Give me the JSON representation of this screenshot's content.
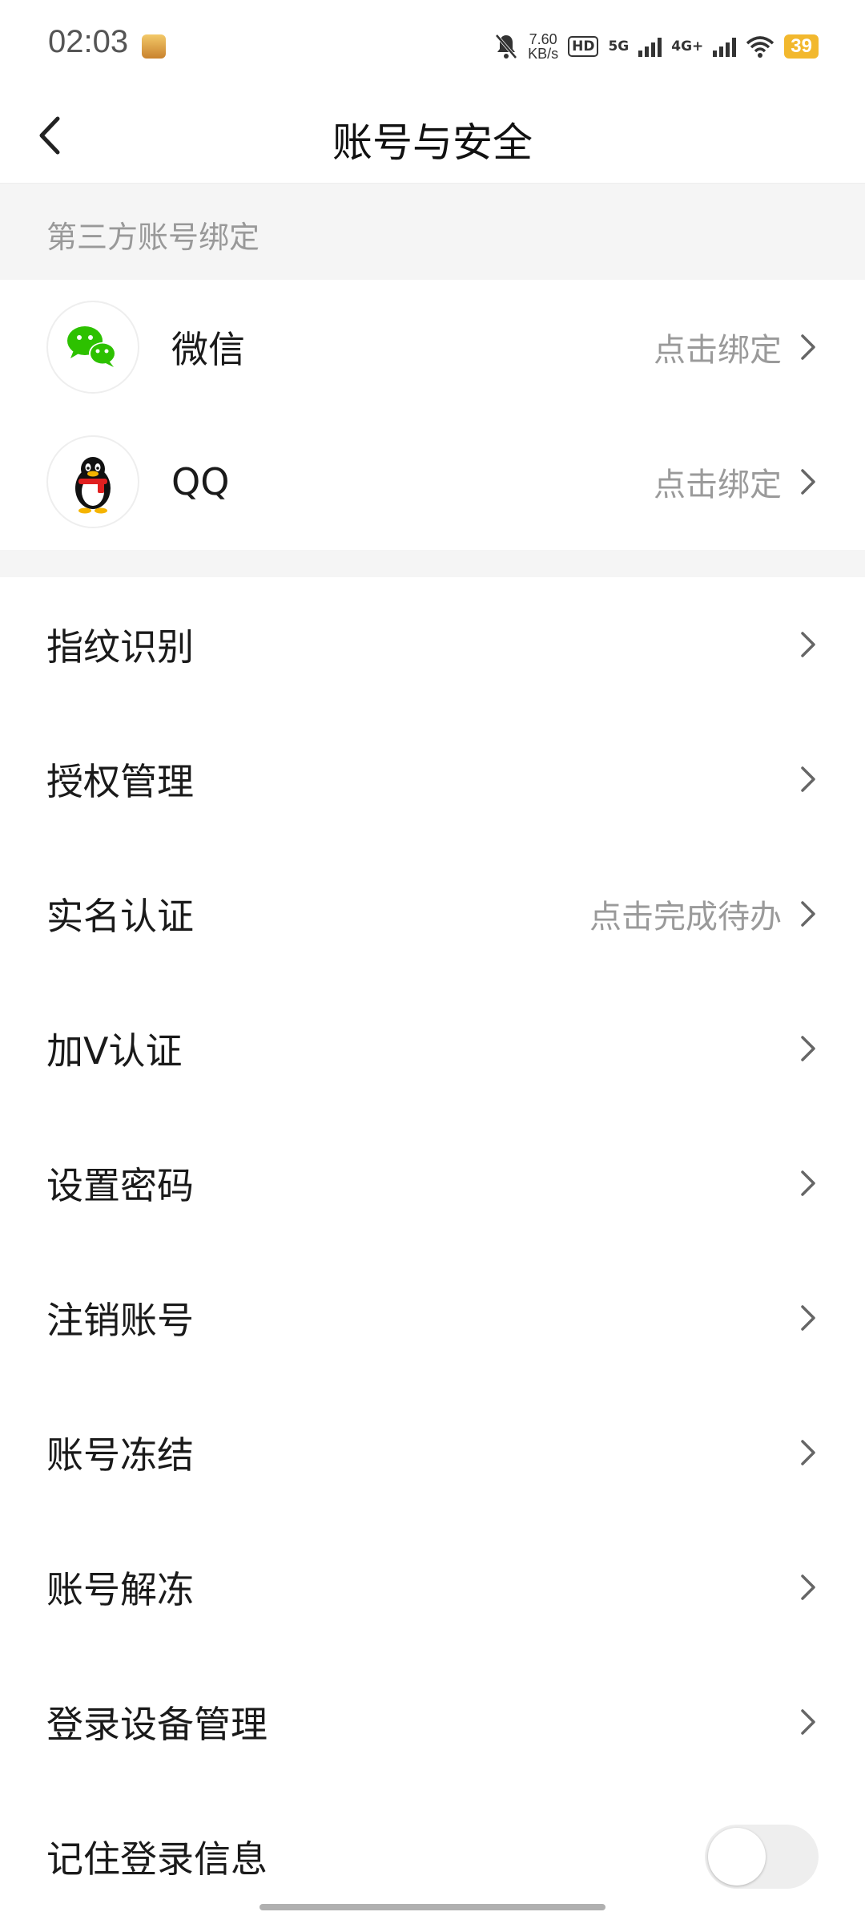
{
  "status_bar": {
    "time": "02:03",
    "net_speed_value": "7.60",
    "net_speed_unit": "KB/s",
    "hd": "HD",
    "net_5g": "5G",
    "net_4g": "4G+",
    "battery": "39",
    "battery_color": "#f2b82e"
  },
  "header": {
    "title": "账号与安全"
  },
  "third_party": {
    "section_title": "第三方账号绑定",
    "accounts": [
      {
        "name": "微信",
        "action": "点击绑定",
        "icon": "wechat-icon"
      },
      {
        "name": "QQ",
        "action": "点击绑定",
        "icon": "qq-penguin-icon"
      }
    ]
  },
  "settings": {
    "items": [
      {
        "label": "指纹识别",
        "value": ""
      },
      {
        "label": "授权管理",
        "value": ""
      },
      {
        "label": "实名认证",
        "value": "点击完成待办"
      },
      {
        "label": "加V认证",
        "value": ""
      },
      {
        "label": "设置密码",
        "value": ""
      },
      {
        "label": "注销账号",
        "value": ""
      },
      {
        "label": "账号冻结",
        "value": ""
      },
      {
        "label": "账号解冻",
        "value": ""
      },
      {
        "label": "登录设备管理",
        "value": ""
      }
    ],
    "remember_login": {
      "label": "记住登录信息",
      "enabled": false
    }
  },
  "colors": {
    "wechat_green": "#2dc100",
    "text_secondary": "#9a9a9a",
    "section_bg": "#f5f5f5"
  }
}
